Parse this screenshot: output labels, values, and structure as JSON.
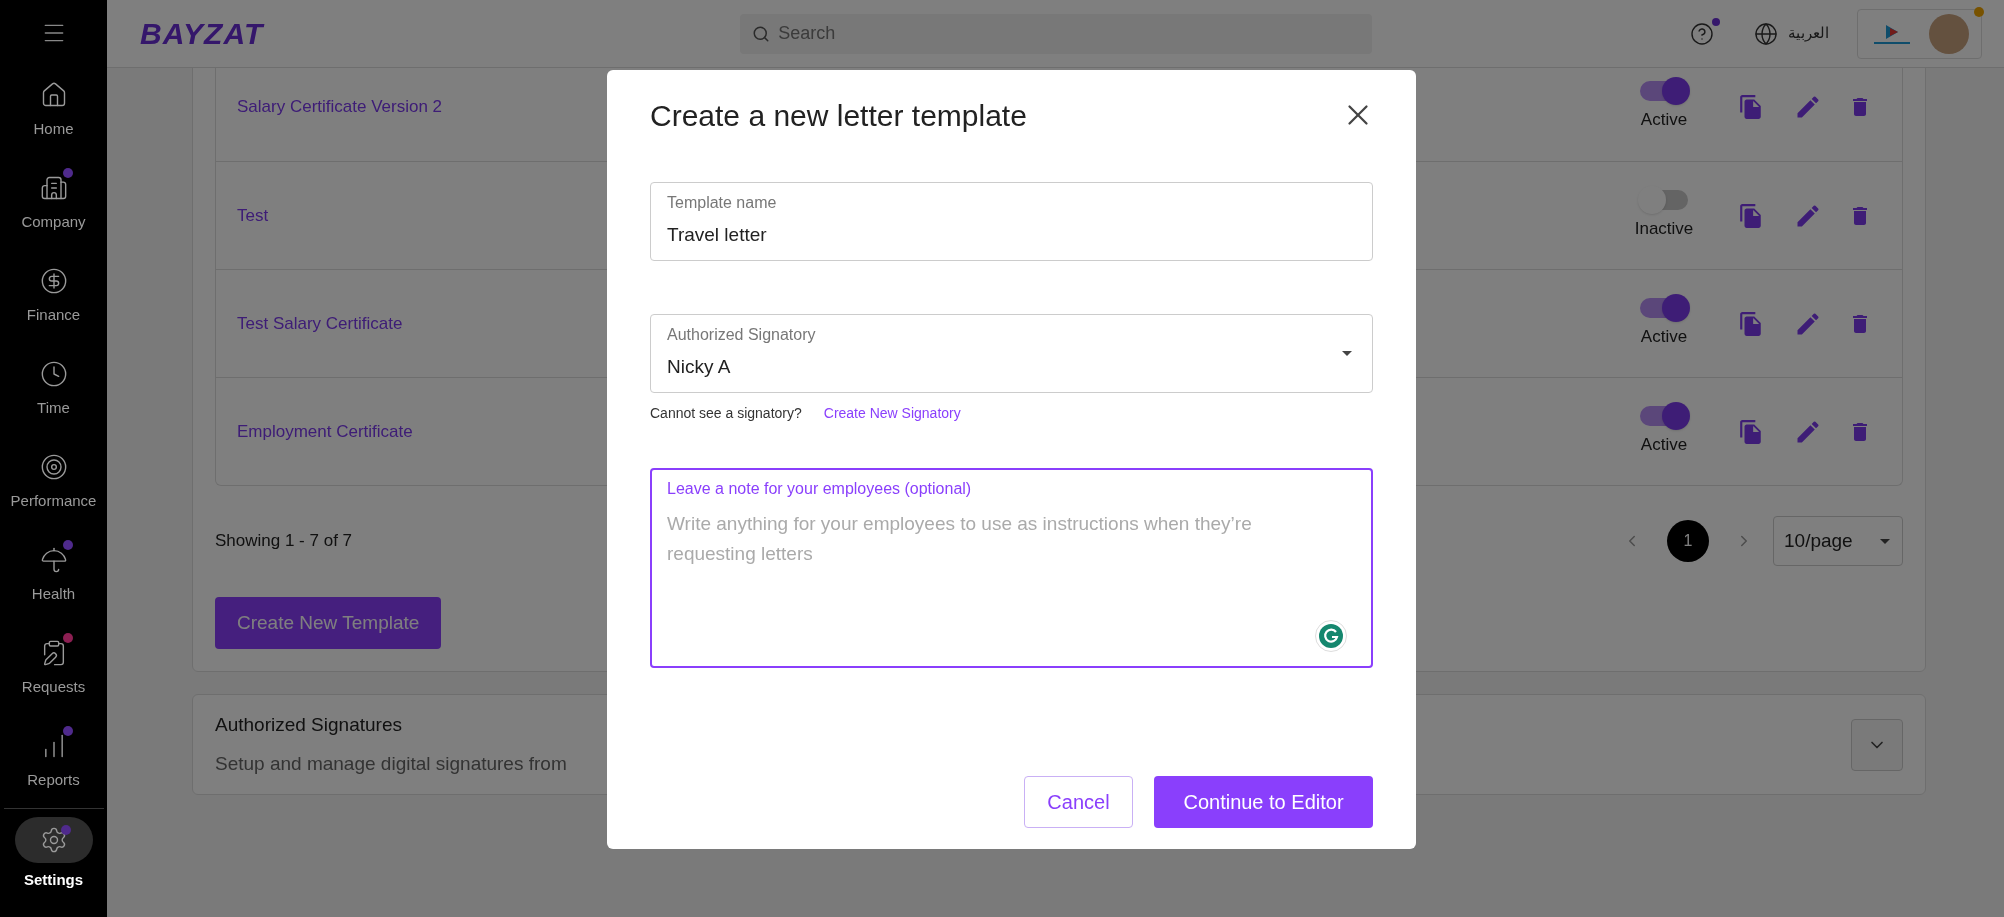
{
  "sidebar": {
    "items": [
      {
        "label": "Home",
        "selected": false
      },
      {
        "label": "Company",
        "selected": false,
        "color": "#4f2a8c"
      },
      {
        "label": "Finance",
        "selected": false
      },
      {
        "label": "Time",
        "selected": false
      },
      {
        "label": "Performance",
        "selected": false
      },
      {
        "label": "Health",
        "selected": false,
        "color": "#4f2a8c"
      },
      {
        "label": "Requests",
        "selected": false,
        "color": "#8c1f52"
      },
      {
        "label": "Reports",
        "selected": false,
        "color": "#4f2a8c"
      },
      {
        "label": "Settings",
        "selected": true,
        "color": "#4f2a8c"
      }
    ]
  },
  "header": {
    "logo": "BAYZAT",
    "search": {
      "placeholder": "Search"
    },
    "language": "العربية"
  },
  "templates": {
    "rows": [
      {
        "name": "Salary Certificate Version 2",
        "on": true,
        "status": "Active"
      },
      {
        "name": "Test",
        "on": false,
        "status": "Inactive"
      },
      {
        "name": "Test Salary Certificate",
        "on": true,
        "status": "Active"
      },
      {
        "name": "Employment Certificate",
        "on": true,
        "status": "Active"
      }
    ],
    "summary": "Showing 1 - 7 of 7",
    "pages": [
      {
        "label": "1",
        "selected": true
      }
    ],
    "page_size": "10/page",
    "create_button": "Create New Template"
  },
  "signatures": {
    "title": "Authorized Signatures",
    "description": "Setup and manage digital signatures from"
  },
  "dialog": {
    "title": "Create a new letter template",
    "template_name": {
      "label": "Template name",
      "value": "Travel letter"
    },
    "signatory": {
      "label": "Authorized Signatory",
      "value": "Nicky A"
    },
    "hint": "Cannot see a signatory?",
    "hint_link": "Create New Signatory",
    "note": {
      "label": "Leave a note for your employees (optional)",
      "placeholder": "Write anything for your employees to use as instructions when they’re requesting letters"
    },
    "cancel": "Cancel",
    "confirm": "Continue to Editor"
  }
}
